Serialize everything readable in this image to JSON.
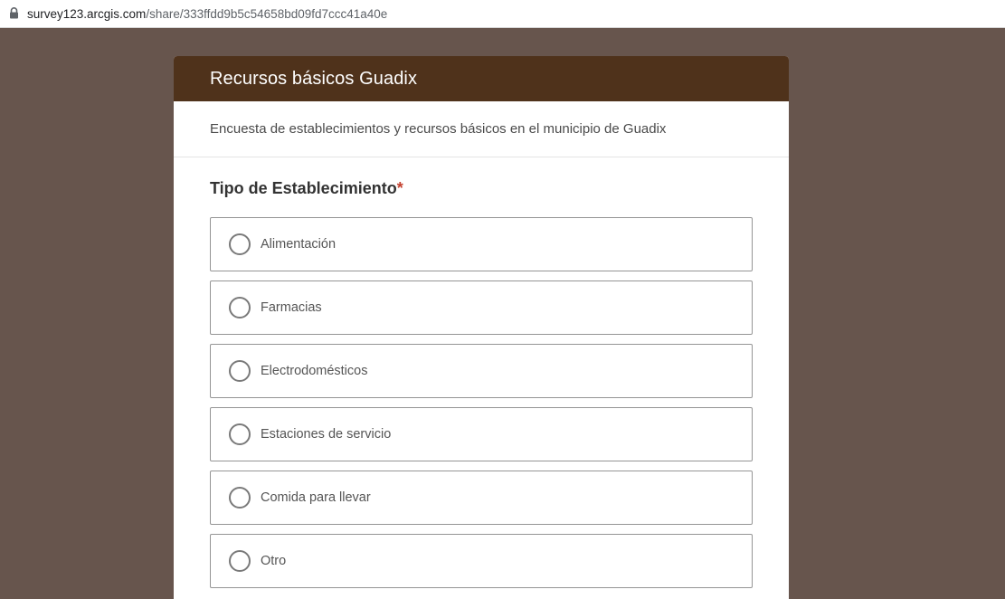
{
  "browser": {
    "url_domain": "survey123.arcgis.com",
    "url_path": "/share/333ffdd9b5c54658bd09fd7ccc41a40e"
  },
  "survey": {
    "title": "Recursos básicos Guadix",
    "description": "Encuesta de establecimientos y recursos básicos en el municipio de Guadix",
    "header_color": "#4f321b",
    "background_color": "#67554d"
  },
  "question": {
    "label": "Tipo de Establecimiento",
    "required_mark": "*",
    "choices": [
      "Alimentación",
      "Farmacias",
      "Electrodomésticos",
      "Estaciones de servicio",
      "Comida para llevar",
      "Otro"
    ]
  }
}
